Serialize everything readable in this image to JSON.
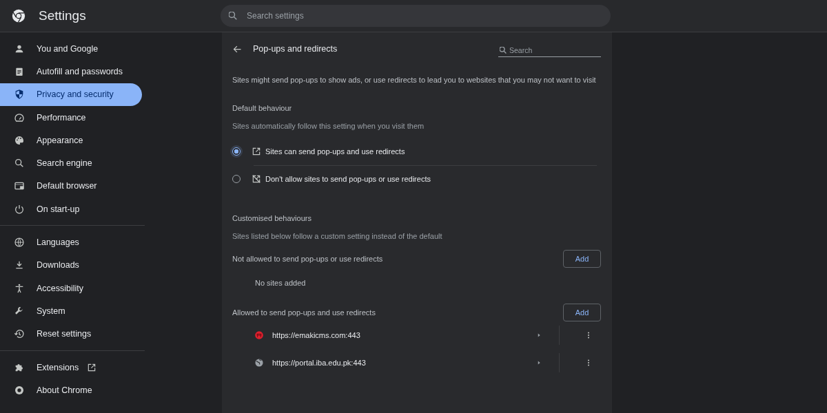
{
  "header": {
    "title": "Settings",
    "search": {
      "placeholder": "Search settings"
    }
  },
  "sidebar": {
    "groups": [
      [
        {
          "label": "You and Google",
          "selected": false,
          "external_link": false
        },
        {
          "label": "Autofill and passwords",
          "selected": false,
          "external_link": false
        },
        {
          "label": "Privacy and security",
          "selected": true,
          "external_link": false
        },
        {
          "label": "Performance",
          "selected": false,
          "external_link": false
        },
        {
          "label": "Appearance",
          "selected": false,
          "external_link": false
        },
        {
          "label": "Search engine",
          "selected": false,
          "external_link": false
        },
        {
          "label": "Default browser",
          "selected": false,
          "external_link": false
        },
        {
          "label": "On start-up",
          "selected": false,
          "external_link": false
        }
      ],
      [
        {
          "label": "Languages",
          "selected": false,
          "external_link": false
        },
        {
          "label": "Downloads",
          "selected": false,
          "external_link": false
        },
        {
          "label": "Accessibility",
          "selected": false,
          "external_link": false
        },
        {
          "label": "System",
          "selected": false,
          "external_link": false
        },
        {
          "label": "Reset settings",
          "selected": false,
          "external_link": false
        }
      ],
      [
        {
          "label": "Extensions",
          "selected": false,
          "external_link": true
        },
        {
          "label": "About Chrome",
          "selected": false,
          "external_link": false
        }
      ]
    ]
  },
  "page": {
    "title": "Pop-ups and redirects",
    "search": {
      "placeholder": "Search"
    },
    "description": "Sites might send pop-ups to show ads, or use redirects to lead you to websites that you may not want to visit",
    "default_section": {
      "heading": "Default behaviour",
      "subtitle": "Sites automatically follow this setting when you visit them",
      "options": [
        {
          "label": "Sites can send pop-ups and use redirects",
          "selected": true
        },
        {
          "label": "Don't allow sites to send pop-ups or use redirects",
          "selected": false
        }
      ]
    },
    "custom_section": {
      "heading": "Customised behaviours",
      "subtitle": "Sites listed below follow a custom setting instead of the default",
      "lists": [
        {
          "title": "Not allowed to send pop-ups or use redirects",
          "button": "Add",
          "empty_text": "No sites added"
        },
        {
          "title": "Allowed to send pop-ups and use redirects",
          "button": "Add",
          "sites": [
            {
              "url": "https://emakicms.com:443",
              "kind": "favicon"
            },
            {
              "url": "https://portal.iba.edu.pk:443",
              "kind": "globe"
            }
          ]
        }
      ]
    }
  }
}
